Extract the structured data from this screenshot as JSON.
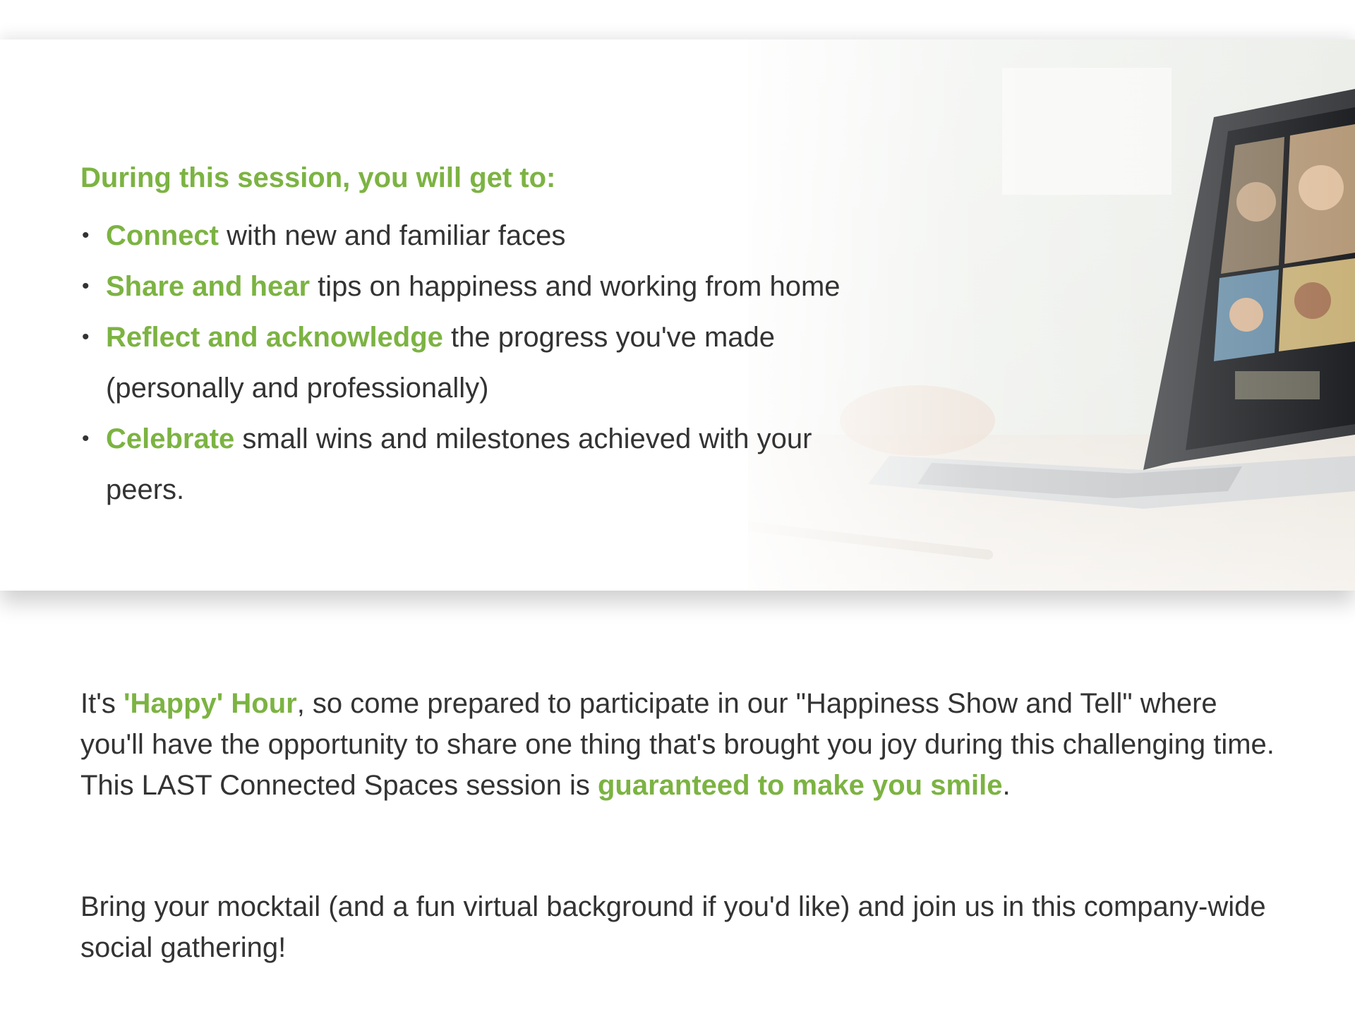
{
  "session": {
    "intro": "During this session, you will get to:",
    "bullets": [
      {
        "highlight": "Connect",
        "text": " with new and familiar faces"
      },
      {
        "highlight": "Share and hear",
        "text": " tips on happiness and working from home"
      },
      {
        "highlight": "Reflect and acknowledge",
        "text": " the progress you've made",
        "text2": "(personally and professionally)"
      },
      {
        "highlight": "Celebrate",
        "text": " small wins and milestones achieved with your",
        "text2": "peers."
      }
    ]
  },
  "details": {
    "p1_a": "It's ",
    "p1_highlight": "'Happy' Hour",
    "p1_b": ", so come prepared to participate in our \"Happiness Show and Tell\" where you'll have the opportunity to share one thing that's brought you joy during this challenging time. This LAST Connected Spaces session is ",
    "p1_highlight2": "guaranteed to make you smile",
    "p1_c": ".",
    "p2": "Bring your mocktail (and a fun virtual background if you'd like) and join us in this company-wide social gathering!"
  },
  "colors": {
    "accent": "#7cb342",
    "text": "#333333"
  },
  "icons": {
    "banner_image": "laptop-video-call-image"
  }
}
